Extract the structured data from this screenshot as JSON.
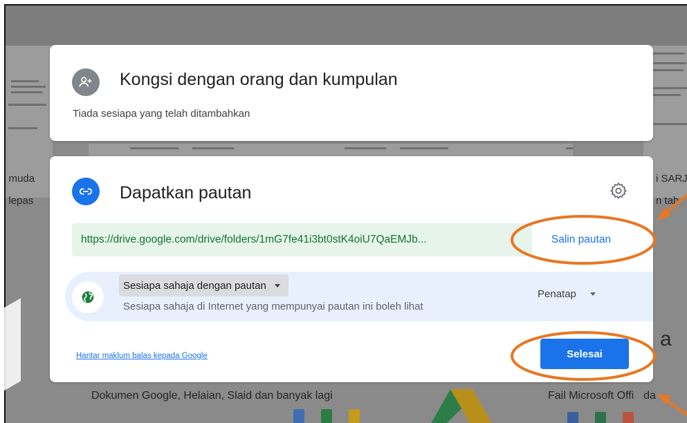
{
  "share_people": {
    "title": "Kongsi dengan orang dan kumpulan",
    "subtitle": "Tiada sesiapa yang telah ditambahkan",
    "icon": "add-person-icon"
  },
  "get_link": {
    "title": "Dapatkan pautan",
    "icon": "link-icon",
    "settings_icon": "gear-icon",
    "url": "https://drive.google.com/drive/folders/1mG7fe41i3bt0stK4oiU7QaEMJb...",
    "copy_label": "Salin pautan",
    "access": {
      "icon": "globe-icon",
      "selected": "Sesiapa sahaja dengan pautan",
      "description": "Sesiapa sahaja di Internet yang mempunyai pautan ini boleh lihat",
      "role": "Penatap"
    },
    "feedback_label": "Hantar maklum balas kepada Google",
    "done_label": "Selesai"
  },
  "background": {
    "left_text_1": "a muda",
    "left_text_2": "n lepas",
    "right_text_1": "i SARJ",
    "right_text_2": "n tah",
    "right_big_letter": "a",
    "footer_left": "Dokumen Google, Helaian, Slaid dan banyak lagi",
    "footer_right": "Fail Microsoft Offi",
    "footer_right_tail": "da"
  },
  "colors": {
    "accent": "#1a73e8",
    "annotation": "#e87722",
    "link_bg": "#e6f4ea",
    "link_text": "#137333",
    "access_bg": "#e8f0fe"
  }
}
